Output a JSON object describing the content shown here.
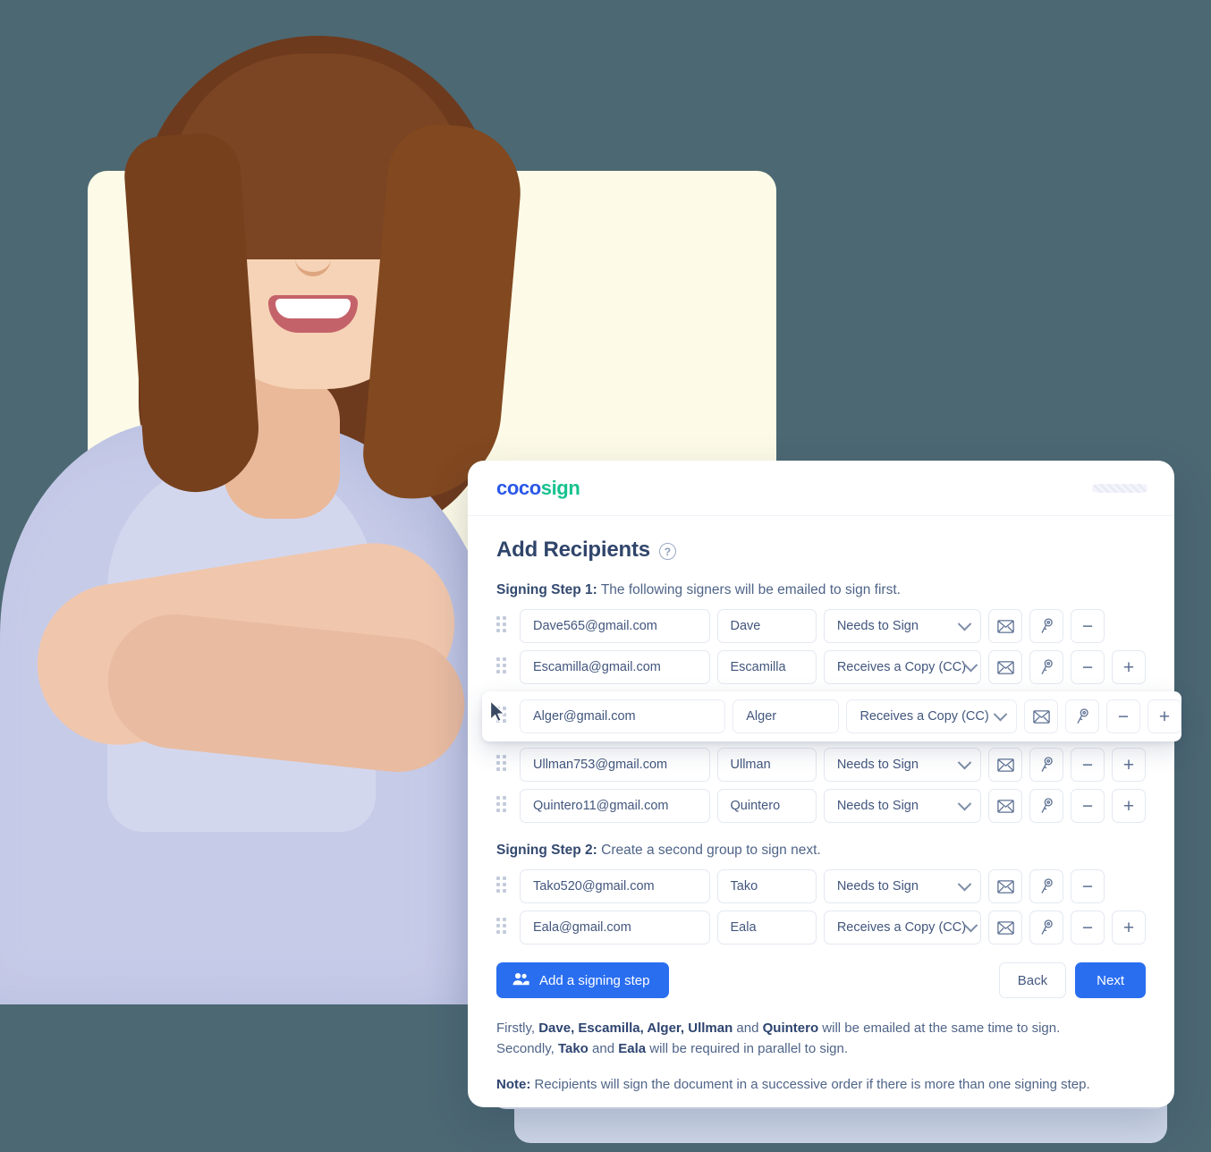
{
  "background": {
    "page_color": "#4c6873",
    "photo_panel_color": "#fdfbe7"
  },
  "brand": {
    "logo_first": "coco",
    "logo_second": "sign",
    "logo_first_color": "#2a58e8",
    "logo_second_color": "#17c28e",
    "accent_blue": "#2a6ef0"
  },
  "header": {
    "pill_placeholder": ""
  },
  "page": {
    "title": "Add Recipients",
    "help_icon": "question-circle-icon",
    "help_glyph": "?"
  },
  "steps": [
    {
      "label_bold": "Signing Step 1:",
      "label_rest": " The following signers will be emailed to sign first.",
      "rows": [
        {
          "email": "Dave565@gmail.com",
          "name": "Dave",
          "role": "Needs to Sign",
          "mail_icon": "envelope-icon",
          "key_icon": "key-icon",
          "remove_label": "−",
          "add_label": "+",
          "has_add": false,
          "dragging": false
        },
        {
          "email": "Escamilla@gmail.com",
          "name": "Escamilla",
          "role": "Receives a Copy (CC)",
          "mail_icon": "envelope-icon",
          "key_icon": "key-icon",
          "remove_label": "−",
          "add_label": "+",
          "has_add": true,
          "dragging": false
        },
        {
          "email": "Alger@gmail.com",
          "name": "Alger",
          "role": "Receives a Copy (CC)",
          "mail_icon": "envelope-icon",
          "key_icon": "key-icon",
          "remove_label": "−",
          "add_label": "+",
          "has_add": true,
          "dragging": true
        },
        {
          "email": "Ullman753@gmail.com",
          "name": "Ullman",
          "role": "Needs to Sign",
          "mail_icon": "envelope-icon",
          "key_icon": "key-icon",
          "remove_label": "−",
          "add_label": "+",
          "has_add": true,
          "dragging": false
        },
        {
          "email": "Quintero11@gmail.com",
          "name": "Quintero",
          "role": "Needs to Sign",
          "mail_icon": "envelope-icon",
          "key_icon": "key-icon",
          "remove_label": "−",
          "add_label": "+",
          "has_add": true,
          "dragging": false
        }
      ]
    },
    {
      "label_bold": "Signing Step 2:",
      "label_rest": " Create a second group to sign next.",
      "rows": [
        {
          "email": "Tako520@gmail.com",
          "name": "Tako",
          "role": "Needs to Sign",
          "mail_icon": "envelope-icon",
          "key_icon": "key-icon",
          "remove_label": "−",
          "add_label": "+",
          "has_add": false,
          "dragging": false
        },
        {
          "email": "Eala@gmail.com",
          "name": "Eala",
          "role": "Receives a Copy (CC)",
          "mail_icon": "envelope-icon",
          "key_icon": "key-icon",
          "remove_label": "−",
          "add_label": "+",
          "has_add": true,
          "dragging": false
        }
      ]
    }
  ],
  "actions": {
    "add_step_label": "Add a signing step",
    "add_step_icon": "users-group-icon",
    "back_label": "Back",
    "next_label": "Next"
  },
  "summary": {
    "line1": [
      {
        "t": "Firstly, ",
        "b": false
      },
      {
        "t": "Dave, Escamilla, Alger, Ullman",
        "b": true
      },
      {
        "t": " and ",
        "b": false
      },
      {
        "t": "Quintero",
        "b": true
      },
      {
        "t": " will be emailed at the same time to sign.",
        "b": false
      }
    ],
    "line2": [
      {
        "t": "Secondly, ",
        "b": false
      },
      {
        "t": "Tako",
        "b": true
      },
      {
        "t": " and ",
        "b": false
      },
      {
        "t": "Eala",
        "b": true
      },
      {
        "t": " will be required in parallel to sign.",
        "b": false
      }
    ],
    "note": [
      {
        "t": "Note:",
        "b": true
      },
      {
        "t": " Recipients will sign the document in a successive order if there is more than one signing step.",
        "b": false
      }
    ]
  }
}
